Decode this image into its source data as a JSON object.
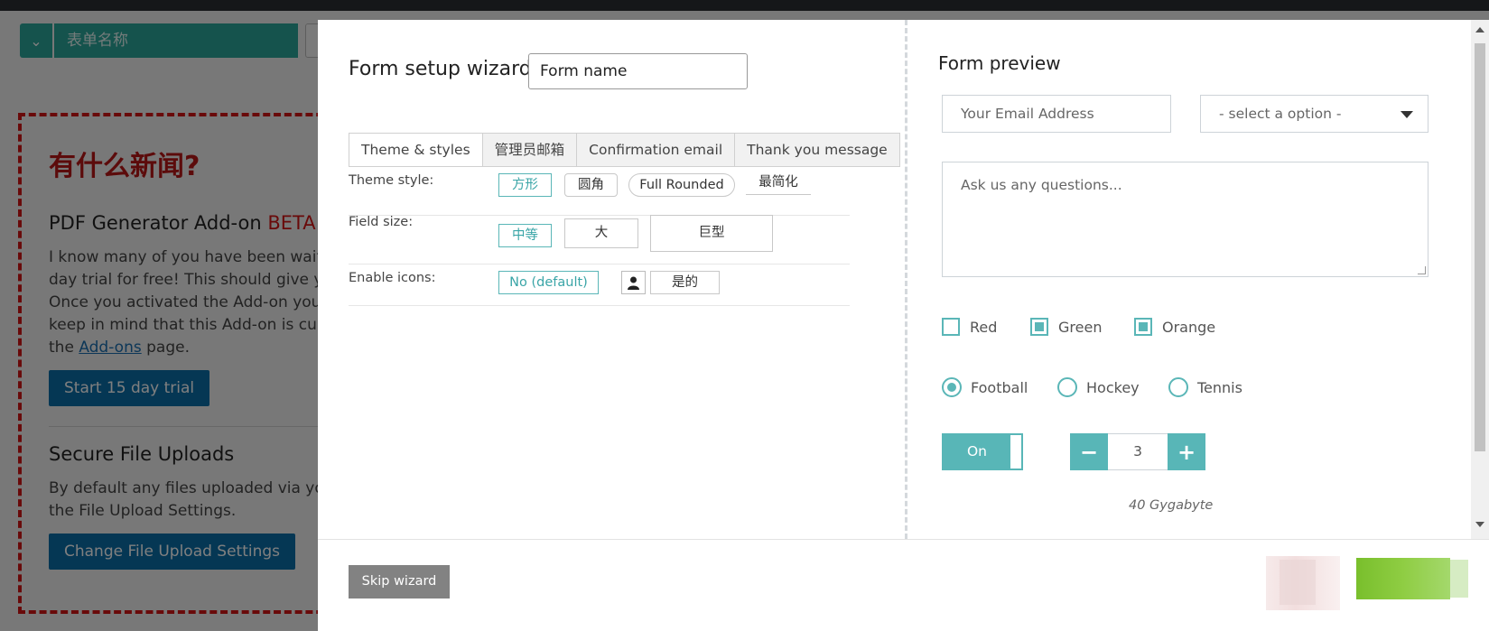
{
  "background": {
    "form_name_placeholder": "表单名称",
    "news": {
      "title": "有什么新闻?",
      "pdf_heading": "PDF Generator Add-on",
      "pdf_badge": "BETA",
      "pdf_text": [
        "I know many of you have been waiti",
        "day trial for free! This should give yo",
        "Once you activated the Add-on you",
        "keep in mind that this Add-on is cur"
      ],
      "pdf_text_last_pre": "the",
      "pdf_text_link": "Add-ons",
      "pdf_text_last_post": "page.",
      "trial_button": "Start 15 day trial",
      "uploads_heading": "Secure File Uploads",
      "uploads_text": [
        "By default any files uploaded via you",
        "the File Upload Settings."
      ],
      "uploads_button": "Change File Upload Settings"
    }
  },
  "wizard": {
    "title": "Form setup wizard",
    "form_name_value": "Form name",
    "tabs": [
      "Theme & styles",
      "管理员邮箱",
      "Confirmation email",
      "Thank you message"
    ],
    "active_tab": 0,
    "options": {
      "theme_style": {
        "label": "Theme style:",
        "choices": [
          "方形",
          "圆角",
          "Full Rounded",
          "最简化"
        ],
        "selected": 0
      },
      "field_size": {
        "label": "Field size:",
        "choices": [
          "中等",
          "大",
          "巨型"
        ],
        "selected": 0
      },
      "enable_icons": {
        "label": "Enable icons:",
        "choices": [
          "No (default)",
          "是的"
        ],
        "selected": 0
      }
    },
    "skip_button": "Skip wizard"
  },
  "preview": {
    "title": "Form preview",
    "email_placeholder": "Your Email Address",
    "select_placeholder": "- select a option -",
    "question_placeholder": "Ask us any questions...",
    "checkboxes": [
      {
        "label": "Red",
        "checked": false
      },
      {
        "label": "Green",
        "checked": true
      },
      {
        "label": "Orange",
        "checked": true
      }
    ],
    "radios": [
      {
        "label": "Football",
        "checked": true
      },
      {
        "label": "Hockey",
        "checked": false
      },
      {
        "label": "Tennis",
        "checked": false
      }
    ],
    "toggle_label": "On",
    "quantity_value": "3",
    "size_hint": "40 Gygabyte"
  },
  "colors": {
    "accent": "#5ab6b7",
    "background_button": "#0b6ea8",
    "news_red": "#d21414",
    "skip_button": "#828282"
  }
}
